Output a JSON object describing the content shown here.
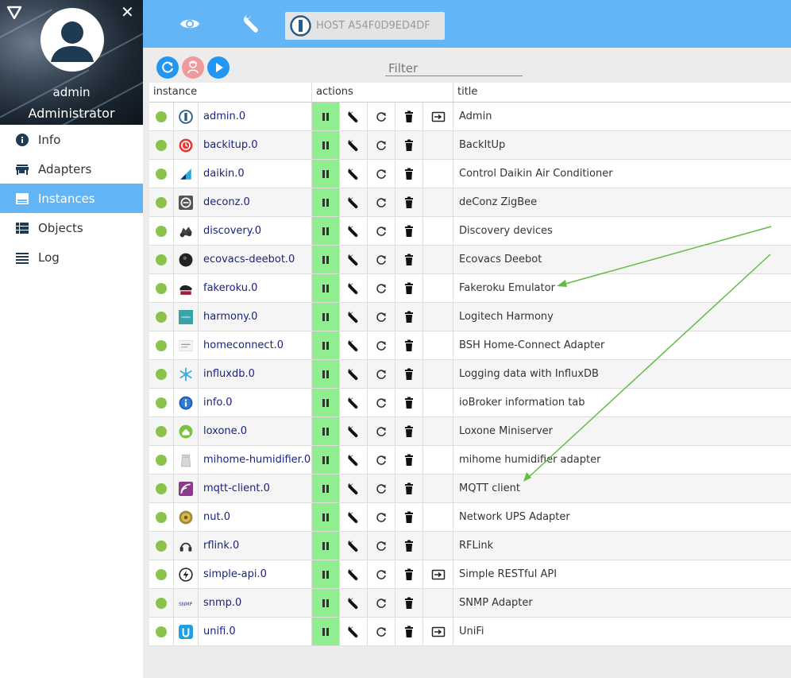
{
  "sidebar": {
    "user": {
      "name": "admin",
      "role": "Administrator"
    },
    "nav": [
      {
        "label": "Info",
        "icon": "info-icon"
      },
      {
        "label": "Adapters",
        "icon": "store-icon"
      },
      {
        "label": "Instances",
        "icon": "instances-icon",
        "active": true
      },
      {
        "label": "Objects",
        "icon": "list-icon"
      },
      {
        "label": "Log",
        "icon": "log-icon"
      }
    ]
  },
  "topbar": {
    "host_label": "HOST A54F0D9ED4DF"
  },
  "toolbar": {
    "filter_placeholder": "Filter"
  },
  "table": {
    "headers": {
      "instance": "instance",
      "actions": "actions",
      "title": "title"
    },
    "rows": [
      {
        "instance": "admin.0",
        "title": "Admin",
        "icon": "iobroker-logo-icon",
        "link": true
      },
      {
        "instance": "backitup.0",
        "title": "BackItUp",
        "icon": "backup-clock-icon",
        "link": false
      },
      {
        "instance": "daikin.0",
        "title": "Control Daikin Air Conditioner",
        "icon": "daikin-logo-icon",
        "link": false
      },
      {
        "instance": "deconz.0",
        "title": "deConz ZigBee",
        "icon": "deconz-logo-icon",
        "link": false
      },
      {
        "instance": "discovery.0",
        "title": "Discovery devices",
        "icon": "binoculars-icon",
        "link": false
      },
      {
        "instance": "ecovacs-deebot.0",
        "title": "Ecovacs Deebot",
        "icon": "robot-vacuum-icon",
        "link": false
      },
      {
        "instance": "fakeroku.0",
        "title": "Fakeroku Emulator",
        "icon": "fakeroku-logo-icon",
        "link": false
      },
      {
        "instance": "harmony.0",
        "title": "Logitech Harmony",
        "icon": "harmony-logo-icon",
        "link": false
      },
      {
        "instance": "homeconnect.0",
        "title": "BSH Home-Connect Adapter",
        "icon": "homeconnect-logo-icon",
        "link": false
      },
      {
        "instance": "influxdb.0",
        "title": "Logging data with InfluxDB",
        "icon": "influxdb-logo-icon",
        "link": false
      },
      {
        "instance": "info.0",
        "title": "ioBroker information tab",
        "icon": "info-logo-icon",
        "link": false
      },
      {
        "instance": "loxone.0",
        "title": "Loxone Miniserver",
        "icon": "loxone-logo-icon",
        "link": false
      },
      {
        "instance": "mihome-humidifier.0",
        "title": "mihome humidifier adapter",
        "icon": "humidifier-icon",
        "link": false
      },
      {
        "instance": "mqtt-client.0",
        "title": "MQTT client",
        "icon": "mqtt-logo-icon",
        "link": false
      },
      {
        "instance": "nut.0",
        "title": "Network UPS Adapter",
        "icon": "nut-logo-icon",
        "link": false
      },
      {
        "instance": "rflink.0",
        "title": "RFLink",
        "icon": "headset-icon",
        "link": false
      },
      {
        "instance": "simple-api.0",
        "title": "Simple RESTful API",
        "icon": "lightning-icon",
        "link": true
      },
      {
        "instance": "snmp.0",
        "title": "SNMP Adapter",
        "icon": "snmp-logo-icon",
        "link": false
      },
      {
        "instance": "unifi.0",
        "title": "UniFi",
        "icon": "unifi-logo-icon",
        "link": true
      }
    ],
    "snmp_logo_text": "SNMP"
  },
  "colors": {
    "primary": "#64b5f6",
    "status_ok": "#8bc34a",
    "run_cell": "#90ee90",
    "link": "#1a237e",
    "arrow": "#66bb44"
  }
}
